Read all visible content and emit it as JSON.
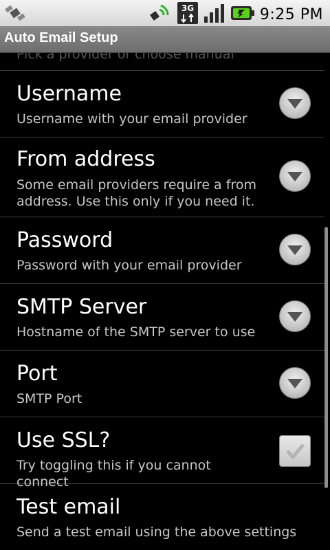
{
  "status_bar": {
    "time": "9:25 PM",
    "network_label": "3G",
    "icons": [
      "satellite-icon",
      "signal-waves-icon",
      "3g-data-icon",
      "signal-strength-icon",
      "battery-icon"
    ]
  },
  "app": {
    "title": "Auto Email Setup"
  },
  "settings": {
    "partial_item_subtitle": "Pick a provider or choose manual",
    "items": [
      {
        "title": "Username",
        "subtitle": "Username with your email provider",
        "control": "dropdown"
      },
      {
        "title": "From address",
        "subtitle": "Some email providers require a from address. Use this only if you need it.",
        "control": "dropdown"
      },
      {
        "title": "Password",
        "subtitle": "Password with your email provider",
        "control": "dropdown"
      },
      {
        "title": "SMTP Server",
        "subtitle": "Hostname of the SMTP server to use",
        "control": "dropdown"
      },
      {
        "title": "Port",
        "subtitle": "SMTP Port",
        "control": "dropdown"
      },
      {
        "title": "Use SSL?",
        "subtitle": "Try toggling this if you cannot connect",
        "control": "checkbox",
        "checked": false
      },
      {
        "title": "Test email",
        "subtitle": "Send a test email using the above settings",
        "control": "none"
      }
    ]
  }
}
